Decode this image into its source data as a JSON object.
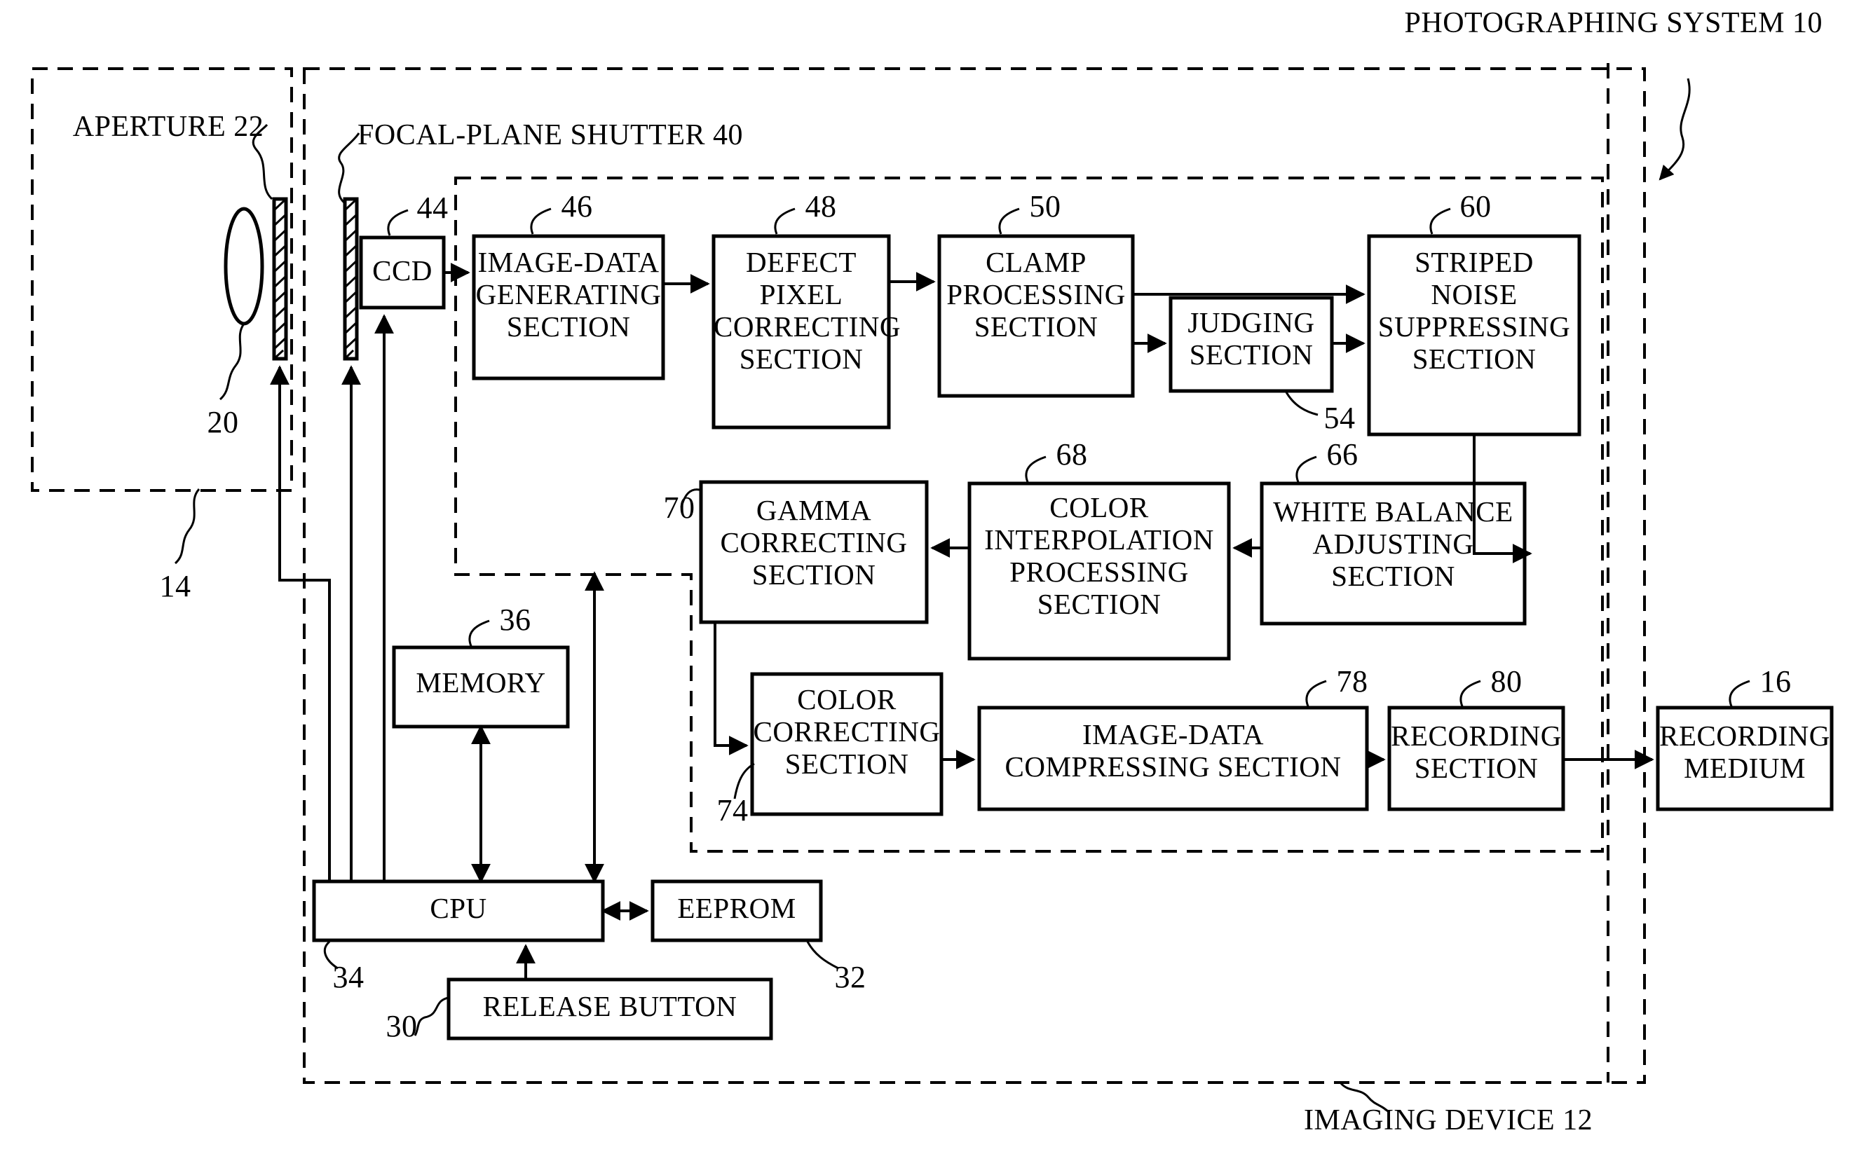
{
  "figure": {
    "title": "Photographing system block diagram",
    "outer_labels": [
      {
        "id": "photographing-system",
        "text": "PHOTOGRAPHING SYSTEM 10"
      },
      {
        "id": "imaging-device",
        "text": "IMAGING DEVICE 12"
      },
      {
        "id": "aperture",
        "text": "APERTURE 22"
      },
      {
        "id": "focal-plane-shutter",
        "text": "FOCAL-PLANE SHUTTER 40"
      }
    ],
    "ref_numerals": [
      {
        "id": "ref-14",
        "text": "14"
      },
      {
        "id": "ref-20",
        "text": "20"
      },
      {
        "id": "ref-44",
        "text": "44"
      },
      {
        "id": "ref-46",
        "text": "46"
      },
      {
        "id": "ref-48",
        "text": "48"
      },
      {
        "id": "ref-50",
        "text": "50"
      },
      {
        "id": "ref-54",
        "text": "54"
      },
      {
        "id": "ref-60",
        "text": "60"
      },
      {
        "id": "ref-66",
        "text": "66"
      },
      {
        "id": "ref-68",
        "text": "68"
      },
      {
        "id": "ref-70",
        "text": "70"
      },
      {
        "id": "ref-74",
        "text": "74"
      },
      {
        "id": "ref-78",
        "text": "78"
      },
      {
        "id": "ref-80",
        "text": "80"
      },
      {
        "id": "ref-16",
        "text": "16"
      },
      {
        "id": "ref-36",
        "text": "36"
      },
      {
        "id": "ref-34",
        "text": "34"
      },
      {
        "id": "ref-32",
        "text": "32"
      },
      {
        "id": "ref-30",
        "text": "30"
      }
    ],
    "blocks": [
      {
        "id": "ccd",
        "label": "CCD",
        "ref": "44"
      },
      {
        "id": "image-data-generating-section",
        "label": "IMAGE-DATA\nGENERATING\nSECTION",
        "ref": "46"
      },
      {
        "id": "defect-pixel-correcting-section",
        "label": "DEFECT\nPIXEL\nCORRECTING\nSECTION",
        "ref": "48"
      },
      {
        "id": "clamp-processing-section",
        "label": "CLAMP\nPROCESSING\nSECTION",
        "ref": "50"
      },
      {
        "id": "judging-section",
        "label": "JUDGING\nSECTION",
        "ref": "54"
      },
      {
        "id": "striped-noise-suppressing-section",
        "label": "STRIPED\nNOISE\nSUPPRESSING\nSECTION",
        "ref": "60"
      },
      {
        "id": "white-balance-adjusting-section",
        "label": "WHITE BALANCE\nADJUSTING\nSECTION",
        "ref": "66"
      },
      {
        "id": "color-interpolation-processing-section",
        "label": "COLOR\nINTERPOLATION\nPROCESSING\nSECTION",
        "ref": "68"
      },
      {
        "id": "gamma-correcting-section",
        "label": "GAMMA\nCORRECTING\nSECTION",
        "ref": "70"
      },
      {
        "id": "color-correcting-section",
        "label": "COLOR\nCORRECTING\nSECTION",
        "ref": "74"
      },
      {
        "id": "image-data-compressing-section",
        "label": "IMAGE-DATA\nCOMPRESSING SECTION",
        "ref": "78"
      },
      {
        "id": "recording-section",
        "label": "RECORDING\nSECTION",
        "ref": "80"
      },
      {
        "id": "recording-medium",
        "label": "RECORDING\nMEDIUM",
        "ref": "16"
      },
      {
        "id": "memory",
        "label": "MEMORY",
        "ref": "36"
      },
      {
        "id": "cpu",
        "label": "CPU",
        "ref": "34"
      },
      {
        "id": "eeprom",
        "label": "EEPROM",
        "ref": "32"
      },
      {
        "id": "release-button",
        "label": "RELEASE BUTTON",
        "ref": "30"
      }
    ],
    "colors": {
      "ink": "#000000",
      "paper": "#ffffff"
    }
  }
}
